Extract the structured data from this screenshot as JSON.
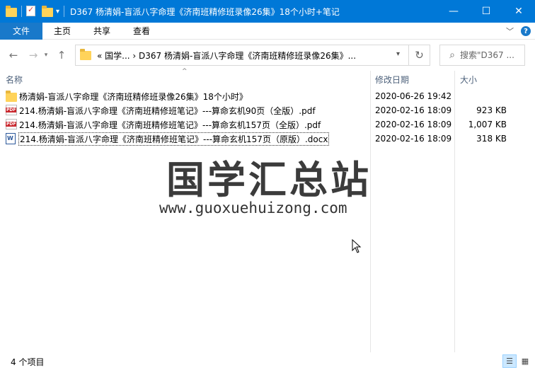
{
  "window": {
    "title": "D367 杨清娟-盲派八字命理《济南班精修班录像26集》18个小时+笔记",
    "minimize_symbol": "—",
    "maximize_symbol": "☐",
    "close_symbol": "✕"
  },
  "ribbon": {
    "tabs": [
      "文件",
      "主页",
      "共享",
      "查看"
    ]
  },
  "navigation": {
    "back_icon": "arrow-left",
    "forward_icon": "arrow-right",
    "up_icon": "arrow-up",
    "address_path": "«  国学...  ›  D367 杨清娟-盲派八字命理《济南班精修班录像26集》...",
    "search_placeholder": "搜索\"D367 ..."
  },
  "columns": {
    "name": "名称",
    "date": "修改日期",
    "size": "大小"
  },
  "files": [
    {
      "name": "杨清娟-盲派八字命理《济南班精修班录像26集》18个小时》",
      "date": "2020-06-26 19:42",
      "size": "",
      "type": "folder"
    },
    {
      "name": "214.杨清娟-盲派八字命理《济南班精修班笔记》---算命玄机90页（全版）.pdf",
      "date": "2020-02-16 18:09",
      "size": "923 KB",
      "type": "pdf"
    },
    {
      "name": "214.杨清娟-盲派八字命理《济南班精修班笔记》---算命玄机157页（全版）.pdf",
      "date": "2020-02-16 18:09",
      "size": "1,007 KB",
      "type": "pdf"
    },
    {
      "name": "214.杨清娟-盲派八字命理《济南班精修班笔记》---算命玄机157页（原版）.docx",
      "date": "2020-02-16 18:09",
      "size": "318 KB",
      "type": "docx"
    }
  ],
  "watermark": {
    "title": "国学汇总站",
    "url": "www.guoxuehuizong.com"
  },
  "status": {
    "item_count": "4 个项目"
  },
  "colors": {
    "titlebar": "#0078d7",
    "file_tab": "#1979ca",
    "folder": "#ffd35a"
  }
}
